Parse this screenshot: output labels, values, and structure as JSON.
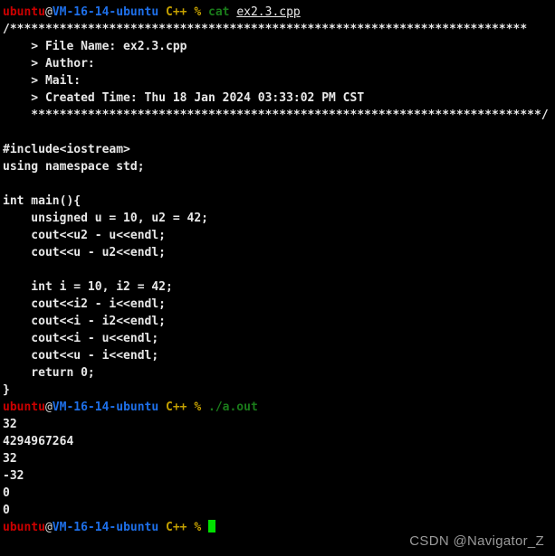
{
  "terminal": {
    "prompt": {
      "user": "ubuntu",
      "at": "@",
      "host": "VM-16-14-ubuntu",
      "context": "C++",
      "symbol": "%"
    },
    "commands": {
      "cat": "cat",
      "cat_arg": "ex2.3.cpp",
      "run": "./a.out"
    },
    "banner_top": "/*************************************************************************",
    "banner_bottom": "    ************************************************************************/",
    "header": {
      "file_name": "    > File Name: ex2.3.cpp",
      "author": "    > Author:",
      "mail": "    > Mail:",
      "created_time": "    > Created Time: Thu 18 Jan 2024 03:33:02 PM CST"
    },
    "source_lines": [
      "#include<iostream>",
      "using namespace std;",
      "",
      "int main(){",
      "    unsigned u = 10, u2 = 42;",
      "    cout<<u2 - u<<endl;",
      "    cout<<u - u2<<endl;",
      "",
      "    int i = 10, i2 = 42;",
      "    cout<<i2 - i<<endl;",
      "    cout<<i - i2<<endl;",
      "    cout<<i - u<<endl;",
      "    cout<<u - i<<endl;",
      "    return 0;",
      "}"
    ],
    "program_output": [
      "32",
      "4294967264",
      "32",
      "-32",
      "0",
      "0"
    ],
    "cursor": "block-cursor"
  },
  "watermark": {
    "text": "CSDN @Navigator_Z"
  },
  "colors": {
    "background": "#000000",
    "user": "#cc0000",
    "host": "#1e6fe8",
    "context": "#c4a000",
    "command": "#1a7b1a",
    "text": "#e8e8e8",
    "cursor": "#00e000",
    "watermark": "#9a9a9a"
  }
}
